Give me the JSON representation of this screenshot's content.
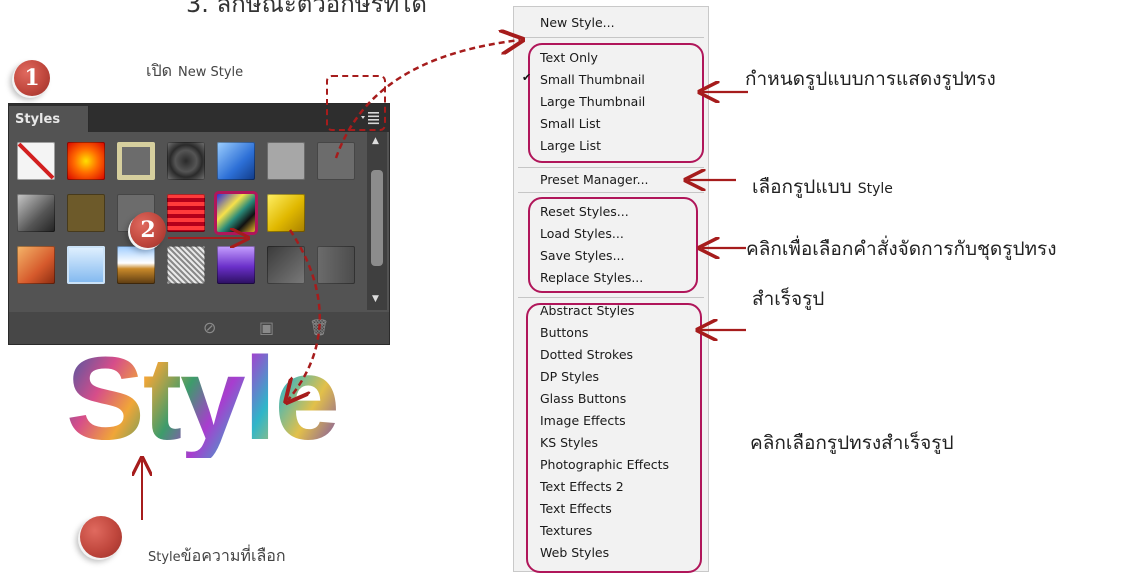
{
  "heading": "3. ลักษณะตัวอักษรที่ได้",
  "badges": {
    "one": "1",
    "two": "2"
  },
  "open_label": {
    "prefix": "เปิด",
    "suffix": "New Style"
  },
  "panel": {
    "tab_label": "Styles",
    "menu_icon": "panel-menu-icon",
    "footer_icons": [
      "no-style-icon",
      "new-style-icon",
      "trash-icon"
    ]
  },
  "style_text": "Style",
  "selected_caption": {
    "prefix": "Style",
    "suffix": "ข้อความที่เลือก"
  },
  "menu": {
    "new_style": "New Style...",
    "view_items": [
      "Text Only",
      "Small Thumbnail",
      "Large Thumbnail",
      "Small List",
      "Large List"
    ],
    "checked_item": "Small Thumbnail",
    "preset_manager": "Preset Manager...",
    "manage_items": [
      "Reset Styles...",
      "Load Styles...",
      "Save Styles...",
      "Replace Styles..."
    ],
    "library_items": [
      "Abstract Styles",
      "Buttons",
      "Dotted Strokes",
      "DP Styles",
      "Glass Buttons",
      "Image Effects",
      "KS Styles",
      "Photographic Effects",
      "Text Effects 2",
      "Text Effects",
      "Textures",
      "Web Styles"
    ]
  },
  "notes": {
    "display": "กำหนดรูปแบบการแสดงรูปทรง",
    "preset_prefix": "เลือกรูปแบบ",
    "preset_suffix": "Style",
    "manage_line1": "คลิกเพื่อเลือกคำสั่งจัดการกับชุดรูปทรง",
    "manage_line2": "สำเร็จรูป",
    "library": "คลิกเลือกรูปทรงสำเร็จรูป"
  },
  "colors": {
    "annotation_arrow": "#a61c1c",
    "group_box": "#b0165a",
    "panel_bg": "#535353",
    "badge": "#c0473d"
  }
}
